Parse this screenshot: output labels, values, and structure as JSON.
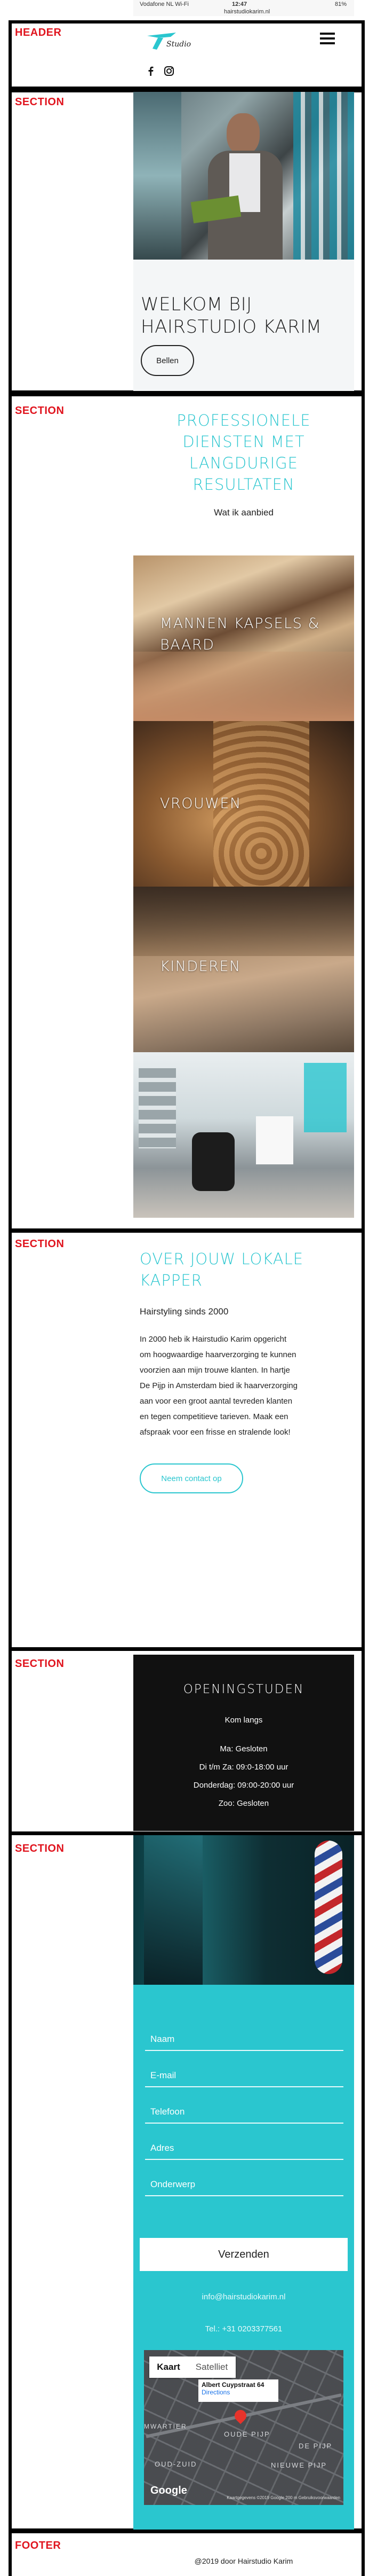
{
  "status_bar": {
    "carrier": "Vodafone NL Wi-Fi",
    "time": "12:47",
    "battery": "81%",
    "url": "hairstudiokarim.nl"
  },
  "labels": {
    "header": "HEADER",
    "section": "SECTION",
    "footer": "FOOTER"
  },
  "header": {
    "logo_text": "Studio",
    "menu_icon": "hamburger-icon",
    "social": [
      "facebook-icon",
      "instagram-icon"
    ]
  },
  "hero": {
    "title_line1": "WELKOM BIJ",
    "title_line2": "HAIRSTUDIO KARIM",
    "call_button": "Bellen"
  },
  "services": {
    "title_lines": [
      "PROFESSIONELE",
      "DIENSTEN MET",
      "LANGDURIGE",
      "RESULTATEN"
    ],
    "subtitle": "Wat ik aanbied",
    "tiles": [
      {
        "label_line1": "MANNEN KAPSELS &",
        "label_line2": "BAARD"
      },
      {
        "label_line1": "VROUWEN",
        "label_line2": ""
      },
      {
        "label_line1": "KINDEREN",
        "label_line2": ""
      }
    ]
  },
  "about": {
    "title_line1": "OVER JOUW LOKALE",
    "title_line2": "KAPPER",
    "subtitle": "Hairstyling sinds 2000",
    "body_lines": [
      "In 2000 heb ik Hairstudio Karim opgericht",
      "om hoogwaardige haarverzorging te kunnen",
      "voorzien aan mijn trouwe klanten. In hartje",
      "De Pijp in Amsterdam bied ik haarverzorging",
      "aan voor een groot aantal tevreden klanten",
      "en tegen competitieve tarieven. Maak een",
      "afspraak voor een frisse en stralende look!"
    ],
    "contact_button": "Neem contact op"
  },
  "hours": {
    "title": "OPENINGSTUDEN",
    "subtitle": "Kom langs",
    "lines": [
      "Ma: Gesloten",
      "Di t/m Za: 09:0-18:00 uur",
      "Donderdag: 09:00-20:00 uur",
      "Zoo: Gesloten"
    ]
  },
  "contact": {
    "fields": [
      "Naam",
      "E-mail",
      "Telefoon",
      "Adres",
      "Onderwerp"
    ],
    "submit": "Verzenden",
    "email": "info@hairstudiokarim.nl",
    "phone": "Tel.: +31 0203377561"
  },
  "map": {
    "tab_map": "Kaart",
    "tab_satellite": "Satelliet",
    "place_name": "Albert Cuypstraat 64",
    "directions": "Directions",
    "areas": [
      "MWARTIER",
      "OUDE PIJP",
      "DE PIJP",
      "OUD-ZUID",
      "NIEUWE PIJP"
    ],
    "google": "Google",
    "footer_text": "Kaartgegevens ©2019 Google   200 m   Gebruiksvoorwaarden"
  },
  "footer": {
    "copyright": "@2019 door Hairstudio Karim"
  },
  "colors": {
    "accent": "#2ac6cf",
    "frame": "#000000",
    "label_red": "#e0141e",
    "dark_panel": "#111111"
  }
}
